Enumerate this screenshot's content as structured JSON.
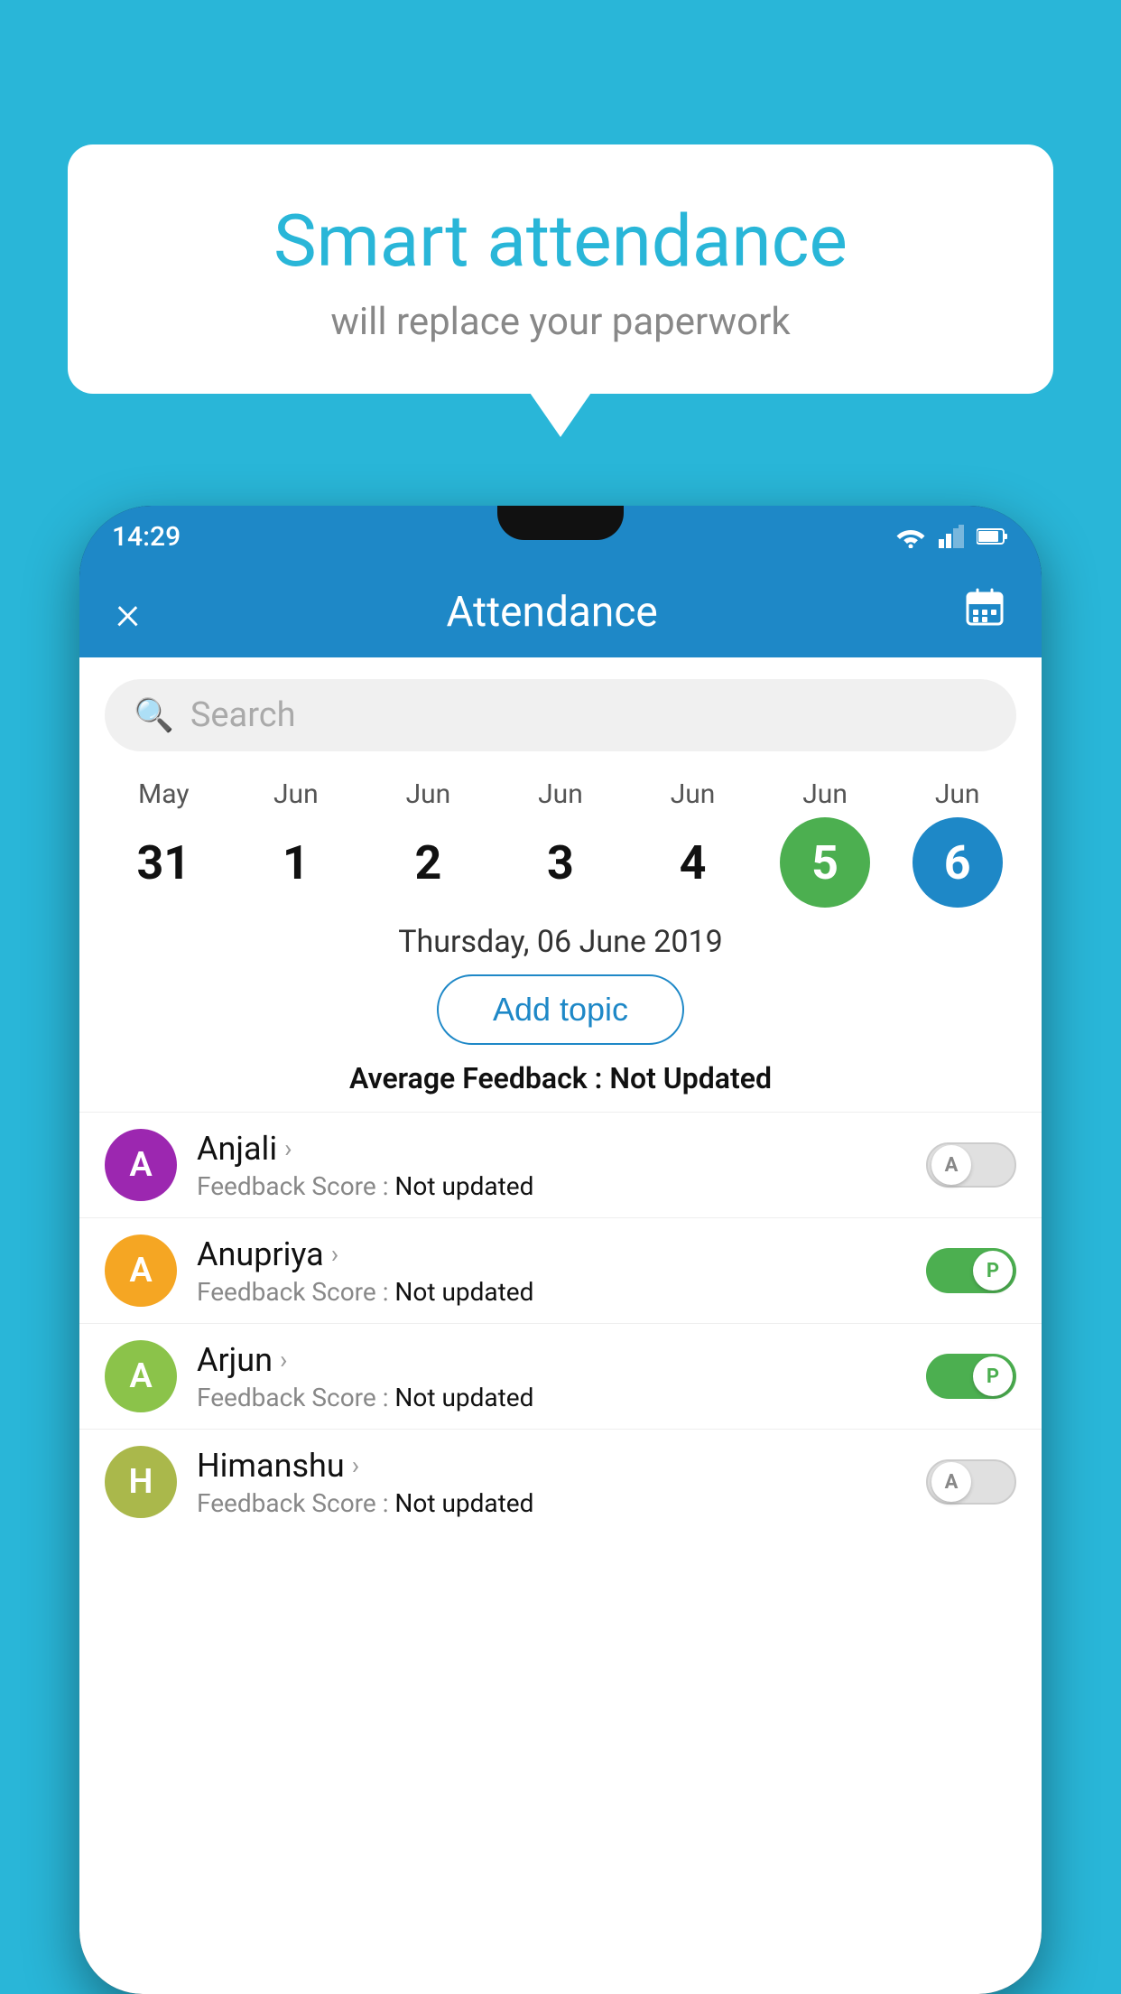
{
  "background_color": "#29b6d8",
  "speech_bubble": {
    "title": "Smart attendance",
    "subtitle": "will replace your paperwork"
  },
  "status_bar": {
    "time": "14:29"
  },
  "app_header": {
    "title": "Attendance",
    "close_label": "×",
    "calendar_label": "📅"
  },
  "search": {
    "placeholder": "Search"
  },
  "date_strip": {
    "dates": [
      {
        "month": "May",
        "day": "31",
        "style": "normal"
      },
      {
        "month": "Jun",
        "day": "1",
        "style": "normal"
      },
      {
        "month": "Jun",
        "day": "2",
        "style": "normal"
      },
      {
        "month": "Jun",
        "day": "3",
        "style": "normal"
      },
      {
        "month": "Jun",
        "day": "4",
        "style": "normal"
      },
      {
        "month": "Jun",
        "day": "5",
        "style": "green"
      },
      {
        "month": "Jun",
        "day": "6",
        "style": "blue"
      }
    ]
  },
  "selected_date_label": "Thursday, 06 June 2019",
  "add_topic_label": "Add topic",
  "avg_feedback_prefix": "Average Feedback : ",
  "avg_feedback_value": "Not Updated",
  "students": [
    {
      "name": "Anjali",
      "initial": "A",
      "color": "#9c27b0",
      "feedback_prefix": "Feedback Score : ",
      "feedback_value": "Not updated",
      "toggle": "off",
      "knob_label": "A"
    },
    {
      "name": "Anupriya",
      "initial": "A",
      "color": "#f5a623",
      "feedback_prefix": "Feedback Score : ",
      "feedback_value": "Not updated",
      "toggle": "on",
      "knob_label": "P"
    },
    {
      "name": "Arjun",
      "initial": "A",
      "color": "#8bc34a",
      "feedback_prefix": "Feedback Score : ",
      "feedback_value": "Not updated",
      "toggle": "on",
      "knob_label": "P"
    },
    {
      "name": "Himanshu",
      "initial": "H",
      "color": "#aab84b",
      "feedback_prefix": "Feedback Score : ",
      "feedback_value": "Not updated",
      "toggle": "off",
      "knob_label": "A"
    }
  ]
}
